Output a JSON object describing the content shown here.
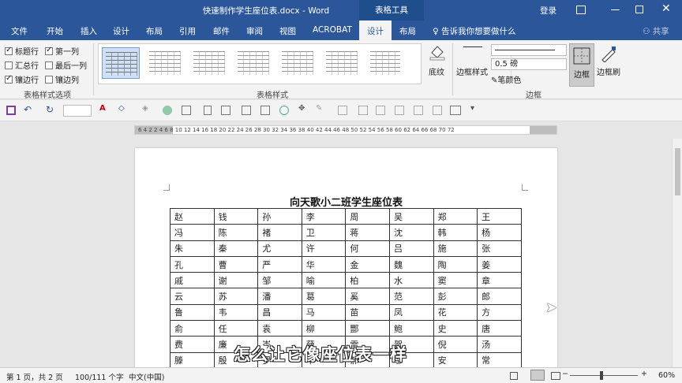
{
  "window": {
    "title": "快速制作学生座位表.docx - Word",
    "tools_header": "表格工具",
    "login": "登录"
  },
  "tabs": [
    "文件",
    "开始",
    "插入",
    "设计",
    "布局",
    "引用",
    "邮件",
    "审阅",
    "视图",
    "ACROBAT",
    "设计",
    "布局"
  ],
  "tell_me": "告诉我你想要做什么",
  "share": "共享",
  "ribbon": {
    "options": {
      "header_row": "标题行",
      "first_column": "第一列",
      "total_row": "汇总行",
      "last_column": "最后一列",
      "banded_rows": "镶边行",
      "banded_columns": "镶边列",
      "group_label": "表格样式选项"
    },
    "styles_group_label": "表格样式",
    "shading": "底纹",
    "border_styles": "边框样式",
    "line_weight": "0.5 磅",
    "pen_color": "笔颜色",
    "borders": "边框",
    "border_painter": "边框刷",
    "borders_group_label": "边框"
  },
  "ruler_text": "6 4 2   2 4 6 8 10 12 14 16 18 20 22 24 26 28 30 32 34 36 38 40 42 44 46 48 50 52 54 56 58 60 62 64 66 68 70 72",
  "document": {
    "title": "向天歌小二班学生座位表",
    "rows": [
      [
        "赵",
        "钱",
        "孙",
        "李",
        "周",
        "吴",
        "郑",
        "王"
      ],
      [
        "冯",
        "陈",
        "褚",
        "卫",
        "蒋",
        "沈",
        "韩",
        "杨"
      ],
      [
        "朱",
        "秦",
        "尤",
        "许",
        "何",
        "吕",
        "施",
        "张"
      ],
      [
        "孔",
        "曹",
        "严",
        "华",
        "金",
        "魏",
        "陶",
        "姜"
      ],
      [
        "戚",
        "谢",
        "邹",
        "喻",
        "柏",
        "水",
        "窦",
        "章"
      ],
      [
        "云",
        "苏",
        "潘",
        "葛",
        "奚",
        "范",
        "彭",
        "郎"
      ],
      [
        "鲁",
        "韦",
        "昌",
        "马",
        "苗",
        "凤",
        "花",
        "方"
      ],
      [
        "俞",
        "任",
        "袁",
        "柳",
        "酆",
        "鲍",
        "史",
        "唐"
      ],
      [
        "费",
        "廉",
        "岑",
        "薛",
        "雷",
        "贺",
        "倪",
        "汤"
      ],
      [
        "滕",
        "殷",
        "罗",
        "毕",
        "郝",
        "邬",
        "安",
        "常"
      ]
    ]
  },
  "subtitle": "怎么让它像座位表一样",
  "status": {
    "page": "第 1 页，共 2 页",
    "words": "100/111 个字",
    "language": "中文(中国)",
    "zoom": "60%"
  }
}
